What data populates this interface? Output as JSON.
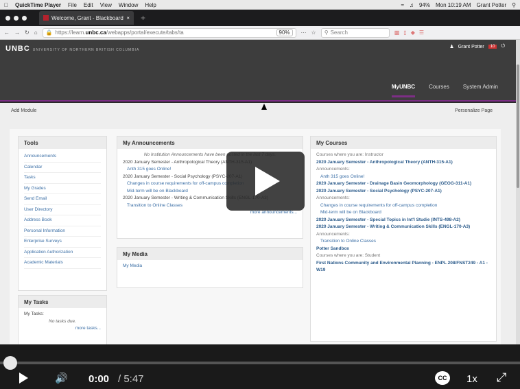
{
  "menubar": {
    "app": "QuickTime Player",
    "items": [
      "File",
      "Edit",
      "View",
      "Window",
      "Help"
    ],
    "battery": "94%",
    "clock": "Mon 10:19 AM",
    "user": "Grant Potter"
  },
  "browser": {
    "tab_title": "Welcome, Grant - Blackboard",
    "url_prefix": "https://learn.",
    "url_domain": "unbc.ca",
    "url_path": "/webapps/portal/execute/tabs/ta",
    "zoom": "90%",
    "search_placeholder": "Search"
  },
  "header": {
    "logo": "UNBC",
    "logo_sub": "UNIVERSITY OF NORTHERN BRITISH COLUMBIA",
    "user": "Grant Potter",
    "nav": [
      "MyUNBC",
      "Courses",
      "System Admin"
    ]
  },
  "modbar": {
    "add": "Add Module",
    "personalize": "Personalize Page"
  },
  "tools": {
    "title": "Tools",
    "items": [
      "Announcements",
      "Calendar",
      "Tasks",
      "My Grades",
      "Send Email",
      "User Directory",
      "Address Book",
      "Personal Information",
      "Enterprise Surveys",
      "Application Authorization",
      "Academic Materials"
    ]
  },
  "tasks": {
    "title": "My Tasks",
    "label": "My Tasks:",
    "none": "No tasks due.",
    "more": "more tasks..."
  },
  "announcements": {
    "title": "My Announcements",
    "none": "No Institution Announcements have been posted in the last 7 days.",
    "c1": "2020 January Semester - Anthropological Theory (ANTH-315-A1)",
    "c1a": "Anth 315 goes Online!",
    "c2": "2020 January Semester - Social Psychology (PSYC-207-A1)",
    "c2a": "Changes in course requirements for off-campus completion",
    "c2b": "Mid-term will be on Blackboard",
    "c3": "2020 January Semester - Writing & Communication Skills (ENGL-170-A3)",
    "c3a": "Transition to Online Classes",
    "more": "more announcements..."
  },
  "media": {
    "title": "My Media",
    "link": "My Media"
  },
  "courses": {
    "title": "My Courses",
    "instr": "Courses where you are: Instructor",
    "c1": "2020 January Semester - Anthropological Theory (ANTH-315-A1)",
    "ann": "Announcements:",
    "c1a": "Anth 315 goes Online!",
    "c2": "2020 January Semester - Drainage Basin Geomorphology (GEOG-311-A1)",
    "c3": "2020 January Semester - Social Psychology (PSYC-207-A1)",
    "c3a": "Changes in course requirements for off-campus completion",
    "c3b": "Mid-term will be on Blackboard",
    "c4": "2020 January Semester - Special Topics in Int'l Studie (INTS-498-A2)",
    "c5": "2020 January Semester - Writing & Communication Skills (ENGL-170-A3)",
    "c5a": "Transition to Online Classes",
    "c6": "Potter Sandbox",
    "stud": "Courses where you are: Student",
    "c7": "First Nations Community and Environmental Planning - ENPL 208/FNST249 - A1 - W19"
  },
  "player": {
    "current": "0:00",
    "duration": "/ 5:47",
    "progress": 0,
    "cc": "CC",
    "speed": "1x"
  }
}
